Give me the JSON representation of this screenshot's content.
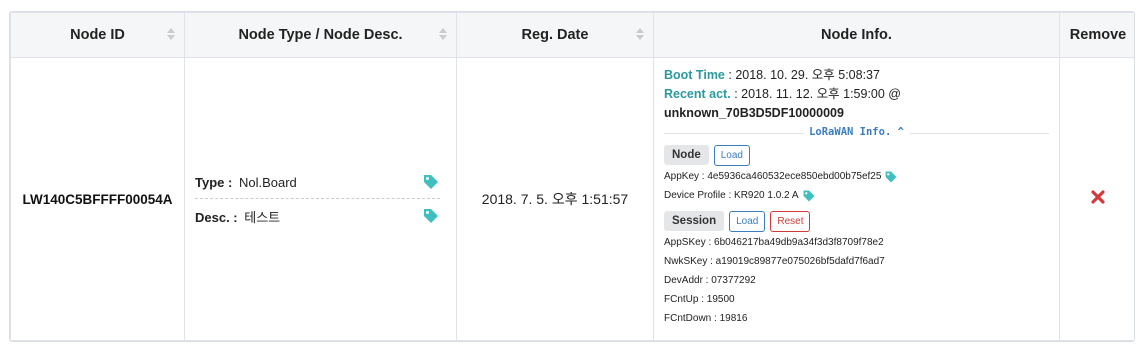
{
  "table": {
    "headers": {
      "node_id": "Node ID",
      "node_type": "Node Type / Node Desc.",
      "reg_date": "Reg. Date",
      "node_info": "Node Info.",
      "remove": "Remove"
    },
    "row": {
      "node_id": "LW140C5BFFFF00054A",
      "type_label": "Type :",
      "type_value": "Nol.Board",
      "desc_label": "Desc. :",
      "desc_value": "테스트",
      "reg_date": "2018. 7. 5. 오후 1:51:57",
      "info": {
        "boot_label": "Boot Time",
        "boot_value": ": 2018. 10. 29. 오후 5:08:37",
        "recent_label": "Recent act.",
        "recent_value": ": 2018. 11. 12. 오후 1:59:00 @",
        "device_name": "unknown_70B3D5DF10000009",
        "lora_title": "LoRaWAN Info. ^",
        "node_btn": "Node",
        "load_btn": "Load",
        "appkey": "AppKey : 4e5936ca460532ece850ebd00b75ef25",
        "device_profile": "Device Profile : KR920 1.0.2 A",
        "session_btn": "Session",
        "session_load_btn": "Load",
        "reset_btn": "Reset",
        "appskey": "AppSKey : 6b046217ba49db9a34f3d3f8709f78e2",
        "nwkskey": "NwkSKey : a19019c89877e075026bf5dafd7f6ad7",
        "devaddr": "DevAddr : 07377292",
        "fcntup": "FCntUp : 19500",
        "fcntdown": "FCntDown : 19816"
      }
    }
  },
  "colors": {
    "accent_teal": "#2a9aa0",
    "tag_icon": "#3fbfbf",
    "link_blue": "#3a7ec1",
    "remove_red": "#d23a3a"
  },
  "icons": {
    "sort": "sort-icon",
    "tag": "tag-icon",
    "remove": "close-icon"
  }
}
